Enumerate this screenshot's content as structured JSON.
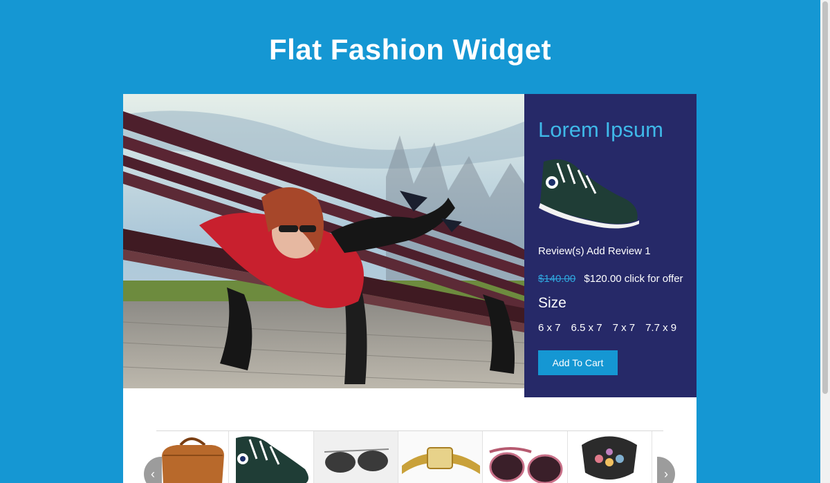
{
  "header": {
    "title": "Flat Fashion Widget"
  },
  "product": {
    "name": "Lorem Ipsum",
    "reviews": "Review(s) Add Review 1",
    "old_price": "$140.00",
    "new_price": "$120.00 click for offer",
    "size_heading": "Size",
    "sizes": [
      "6 x 7",
      "6.5 x 7",
      "7 x 7",
      "7.7 x 9"
    ],
    "cart_label": "Add To Cart"
  },
  "carousel": {
    "prev_icon": "chevron-left-icon",
    "next_icon": "chevron-right-icon",
    "items": [
      "handbag",
      "sneaker",
      "sunglasses",
      "watch",
      "pink-sunglasses",
      "makeup-kit"
    ]
  },
  "colors": {
    "background": "#1597d3",
    "panel": "#262968",
    "accent": "#3fb8e8",
    "button": "#1597d3"
  }
}
